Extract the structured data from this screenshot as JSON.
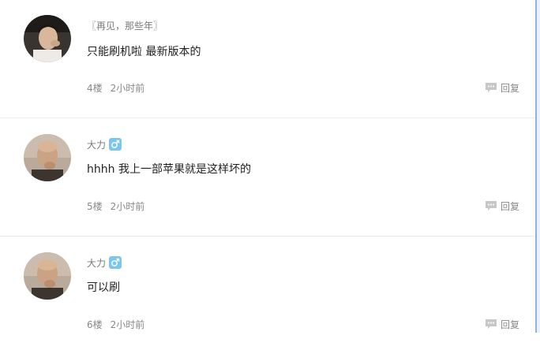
{
  "comments": [
    {
      "username": "〖再见，那些年〗",
      "content": "只能刷机啦 最新版本的",
      "floor": "4楼",
      "time": "2小时前",
      "reply_label": "回复",
      "has_gender_badge": false
    },
    {
      "username": "大力",
      "content": "hhhh 我上一部苹果就是这样坏的",
      "floor": "5楼",
      "time": "2小时前",
      "reply_label": "回复",
      "has_gender_badge": true,
      "gender_icon": "male-icon"
    },
    {
      "username": "大力",
      "content": "可以刷",
      "floor": "6楼",
      "time": "2小时前",
      "reply_label": "回复",
      "has_gender_badge": true,
      "gender_icon": "male-icon"
    }
  ],
  "colors": {
    "badge": "#7cc5ec",
    "meta_text": "#888888",
    "content_text": "#222222"
  }
}
